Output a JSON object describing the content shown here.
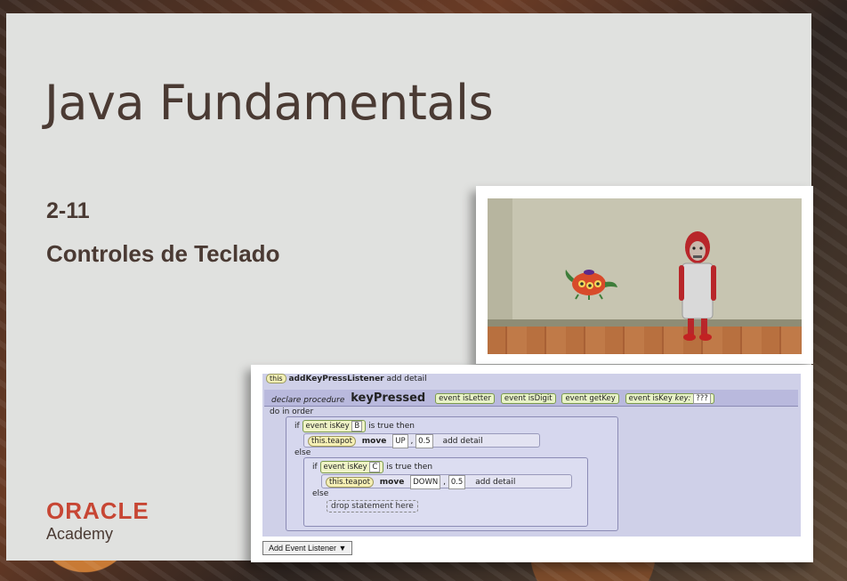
{
  "slide": {
    "title": "Java Fundamentals",
    "lesson_number": "2-11",
    "lesson_title": "Controles de Teclado"
  },
  "brand": {
    "name": "ORACLE",
    "sub": "Academy",
    "color": "#c74634"
  },
  "code": {
    "listener": {
      "target": "this",
      "method": "addKeyPressListener",
      "detail": "add detail"
    },
    "procedure": {
      "declare_label": "declare procedure",
      "name": "keyPressed",
      "params": [
        "event isLetter",
        "event isDigit",
        "event getKey",
        "event isKey"
      ],
      "last_param_key": "key:",
      "last_param_value": "???"
    },
    "do_in_order": "do in order",
    "if1": {
      "if_label": "if",
      "event": "event",
      "method": "isKey",
      "key": "B",
      "then": "is true then",
      "stmt": {
        "obj": "this.teapot",
        "action": "move",
        "dir": "UP",
        "amount": "0.5",
        "detail": "add detail"
      }
    },
    "else1": "else",
    "if2": {
      "if_label": "if",
      "event": "event",
      "method": "isKey",
      "key": "C",
      "then": "is true then",
      "stmt": {
        "obj": "this.teapot",
        "action": "move",
        "dir": "DOWN",
        "amount": "0.5",
        "detail": "add detail"
      }
    },
    "else2": "else",
    "drop_here": "drop statement here",
    "add_event_listener": "Add Event Listener ▼"
  }
}
